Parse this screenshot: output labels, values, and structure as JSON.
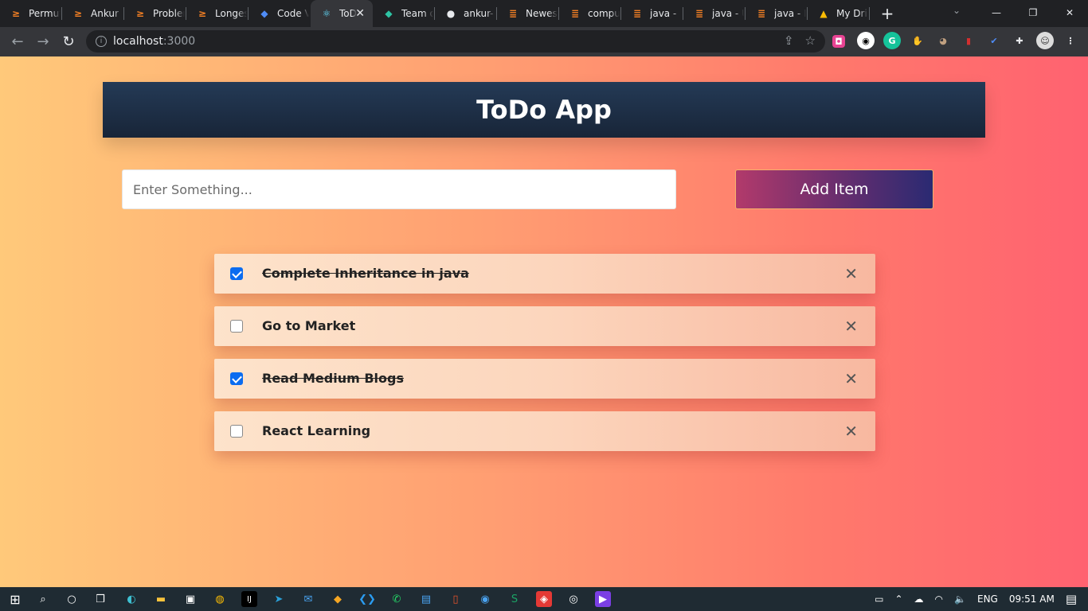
{
  "browser": {
    "tabs": [
      {
        "title": "Permut",
        "icon": "code-icon",
        "color": "#f48024"
      },
      {
        "title": "Ankur",
        "icon": "code-icon",
        "color": "#f48024"
      },
      {
        "title": "Problem",
        "icon": "code-icon",
        "color": "#f48024"
      },
      {
        "title": "Longes",
        "icon": "code-icon",
        "color": "#f48024"
      },
      {
        "title": "Code V",
        "icon": "codev-icon",
        "color": "#4f8cf7"
      },
      {
        "title": "ToD",
        "icon": "react-icon",
        "color": "#61dafb"
      },
      {
        "title": "Team o",
        "icon": "diamond-icon",
        "color": "#2ec4a4"
      },
      {
        "title": "ankur-",
        "icon": "github-icon",
        "color": "#e8eaed"
      },
      {
        "title": "Newest",
        "icon": "stackoverflow-icon",
        "color": "#f48024"
      },
      {
        "title": "compu",
        "icon": "stackoverflow-icon",
        "color": "#f48024"
      },
      {
        "title": "java - ",
        "icon": "stackoverflow-icon",
        "color": "#f48024"
      },
      {
        "title": "java - U",
        "icon": "stackoverflow-icon",
        "color": "#f48024"
      },
      {
        "title": "java - I",
        "icon": "stackoverflow-icon",
        "color": "#f48024"
      },
      {
        "title": "My Dri",
        "icon": "drive-icon",
        "color": "#fbbc04"
      }
    ],
    "active_tab_index": 5,
    "url_host": "localhost",
    "url_port": ":3000"
  },
  "app": {
    "title": "ToDo App",
    "input_placeholder": "Enter Something...",
    "add_button_label": "Add Item",
    "items": [
      {
        "text": "Complete Inheritance in java",
        "done": true
      },
      {
        "text": "Go to Market",
        "done": false
      },
      {
        "text": "Read Medium Blogs",
        "done": true
      },
      {
        "text": "React Learning",
        "done": false
      }
    ],
    "delete_glyph": "✕"
  },
  "taskbar": {
    "language": "ENG",
    "time": "09:51 AM"
  }
}
